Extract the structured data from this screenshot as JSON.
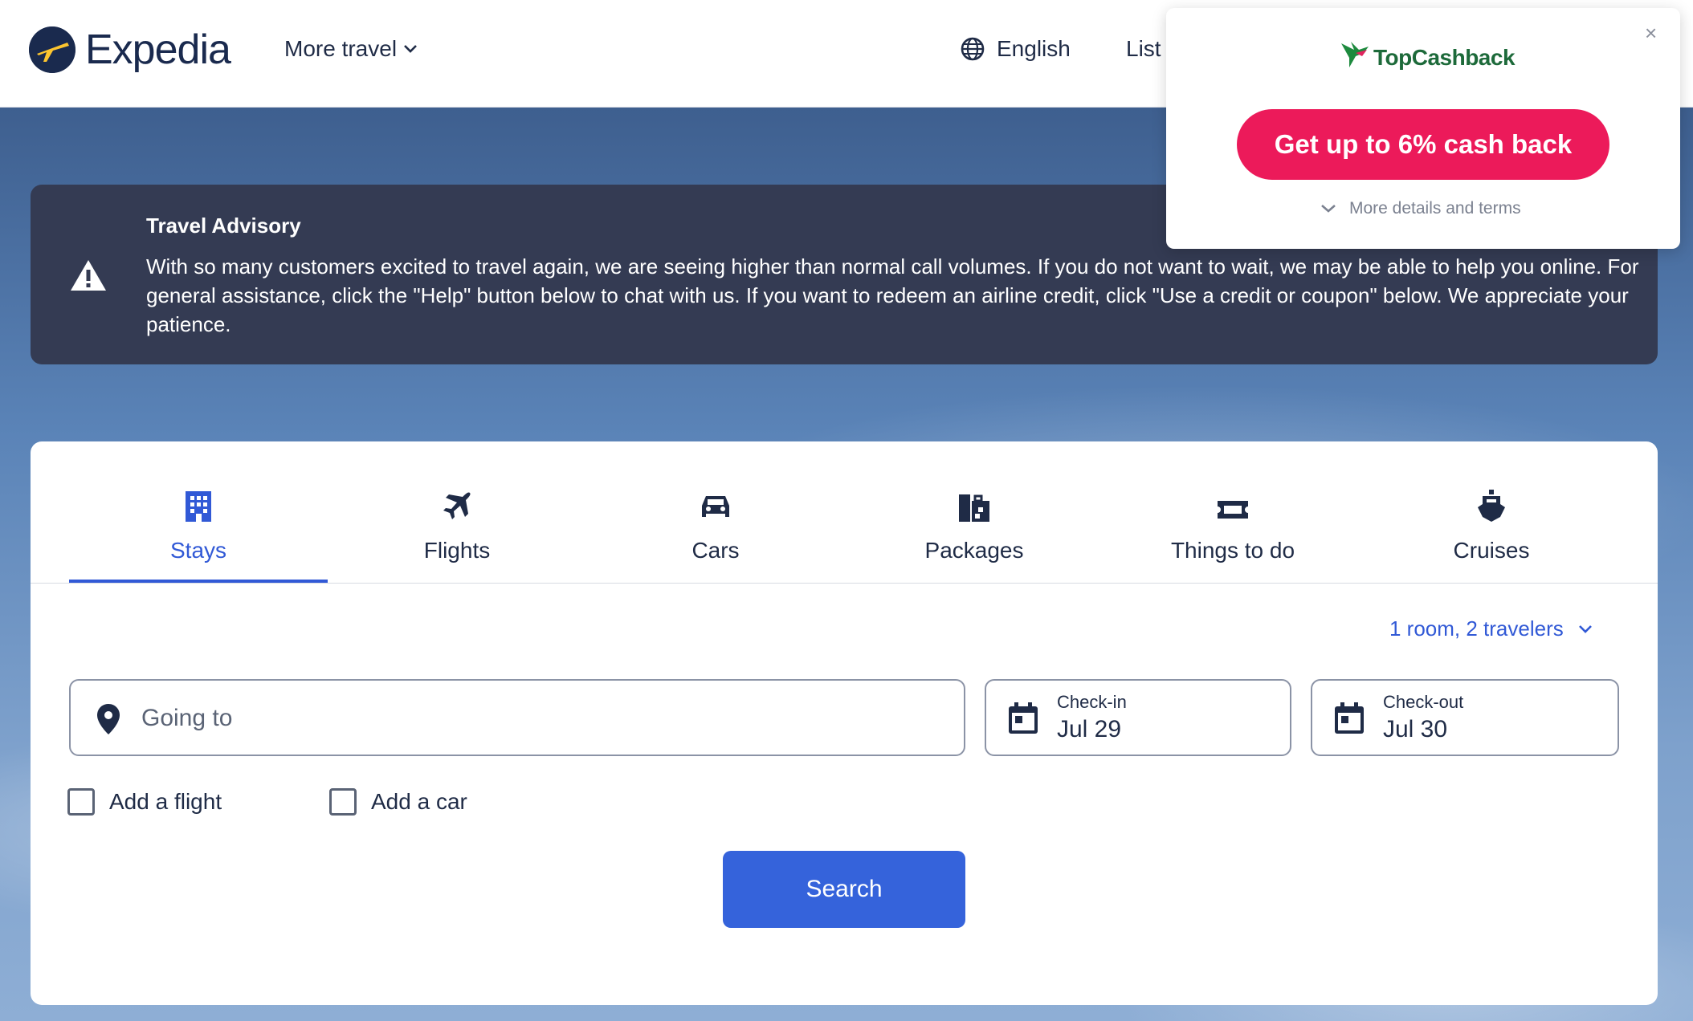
{
  "header": {
    "logo_text": "Expedia",
    "more_travel": "More travel",
    "language": "English",
    "list_link": "List"
  },
  "advisory": {
    "title": "Travel Advisory",
    "body": "With so many customers excited to travel again, we are seeing higher than normal call volumes. If you do not want to wait, we may be able to help you online. For general assistance, click the \"Help\" button below to chat with us. If you want to redeem an airline credit, click \"Use a credit or coupon\" below. We appreciate your patience."
  },
  "tabs": [
    {
      "label": "Stays",
      "icon": "building-icon",
      "active": true
    },
    {
      "label": "Flights",
      "icon": "plane-icon",
      "active": false
    },
    {
      "label": "Cars",
      "icon": "car-icon",
      "active": false
    },
    {
      "label": "Packages",
      "icon": "packages-icon",
      "active": false
    },
    {
      "label": "Things to do",
      "icon": "ticket-icon",
      "active": false
    },
    {
      "label": "Cruises",
      "icon": "ship-icon",
      "active": false
    }
  ],
  "search": {
    "travelers": "1 room, 2 travelers",
    "going_to_placeholder": "Going to",
    "checkin_label": "Check-in",
    "checkin_value": "Jul 29",
    "checkout_label": "Check-out",
    "checkout_value": "Jul 30",
    "add_flight": "Add a flight",
    "add_car": "Add a car",
    "search_button": "Search"
  },
  "popup": {
    "close": "×",
    "brand": "TopCashback",
    "cta": "Get up to 6% cash back",
    "details": "More details and terms"
  },
  "colors": {
    "accent": "#3159d6",
    "search_button": "#3563db",
    "advisory_bg": "#343b53",
    "cashback_cta": "#ec1a5a",
    "brand_dark": "#1a2a4e"
  }
}
